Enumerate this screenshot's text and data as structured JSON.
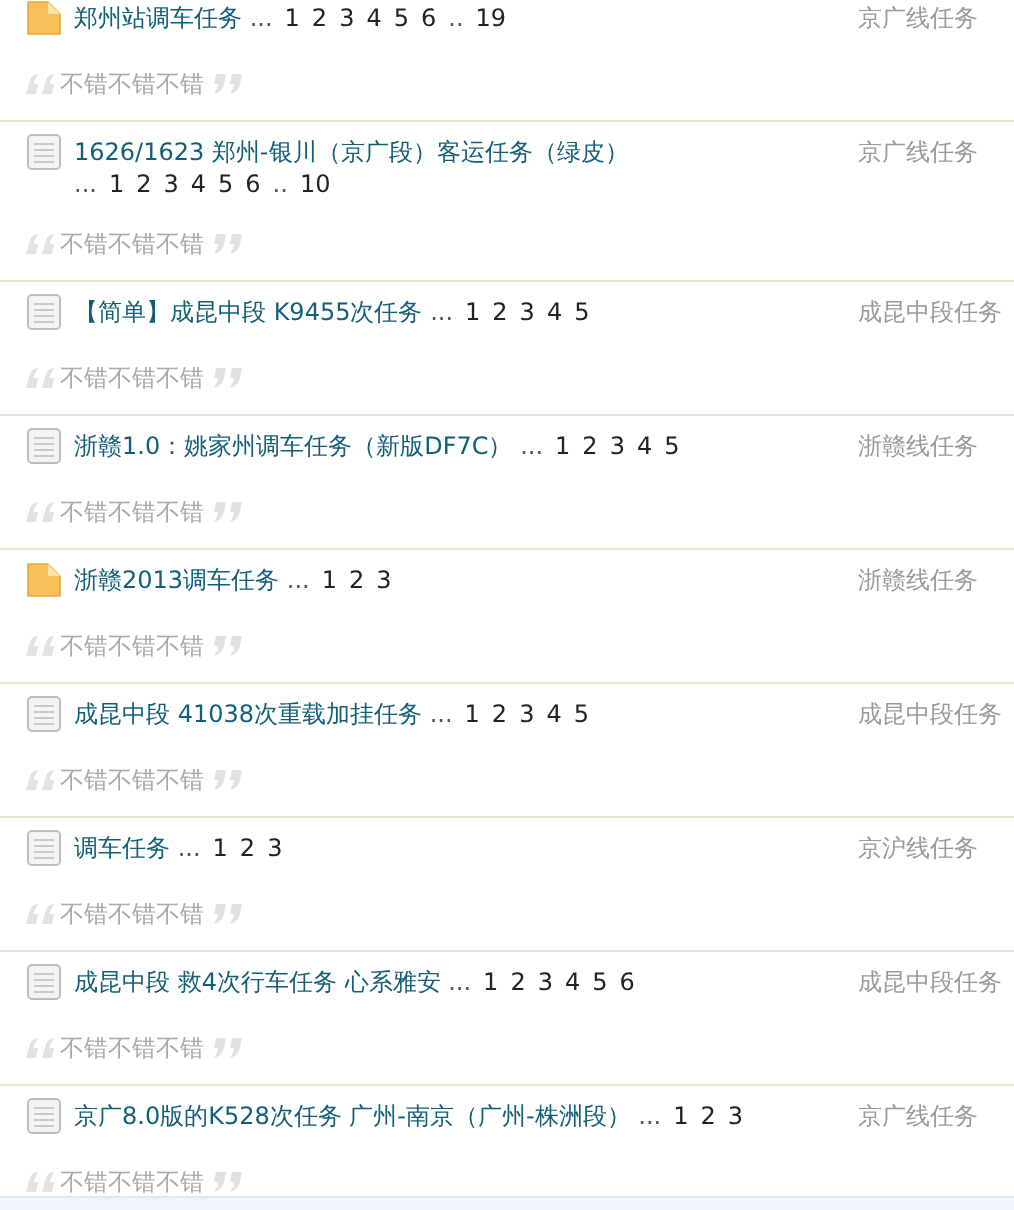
{
  "threads": [
    {
      "kind": "folder",
      "title": "郑州站调车任务",
      "pages": [
        {
          "kind": "gap",
          "text": "..."
        },
        {
          "kind": "link",
          "text": "1"
        },
        {
          "kind": "link",
          "text": "2"
        },
        {
          "kind": "link",
          "text": "3"
        },
        {
          "kind": "link",
          "text": "4"
        },
        {
          "kind": "link",
          "text": "5"
        },
        {
          "kind": "link",
          "text": "6"
        },
        {
          "kind": "gap",
          "text": ".."
        },
        {
          "kind": "link",
          "text": "19"
        }
      ],
      "category": "京广线任务",
      "quote": "不错不错不错"
    },
    {
      "kind": "document",
      "title": "1626/1623 郑州-银川（京广段）客运任务（绿皮）",
      "pages": [
        {
          "kind": "gap",
          "text": "..."
        },
        {
          "kind": "link",
          "text": "1"
        },
        {
          "kind": "link",
          "text": "2"
        },
        {
          "kind": "link",
          "text": "3"
        },
        {
          "kind": "link",
          "text": "4"
        },
        {
          "kind": "link",
          "text": "5"
        },
        {
          "kind": "link",
          "text": "6"
        },
        {
          "kind": "gap",
          "text": ".."
        },
        {
          "kind": "link",
          "text": "10"
        }
      ],
      "category": "京广线任务",
      "quote": "不错不错不错"
    },
    {
      "kind": "document",
      "title": "【简单】成昆中段 K9455次任务",
      "pages": [
        {
          "kind": "gap",
          "text": "..."
        },
        {
          "kind": "link",
          "text": "1"
        },
        {
          "kind": "link",
          "text": "2"
        },
        {
          "kind": "link",
          "text": "3"
        },
        {
          "kind": "link",
          "text": "4"
        },
        {
          "kind": "link",
          "text": "5"
        }
      ],
      "category": "成昆中段任务",
      "quote": "不错不错不错"
    },
    {
      "kind": "document",
      "title": "浙赣1.0：姚家州调车任务（新版DF7C）",
      "pages": [
        {
          "kind": "gap",
          "text": "..."
        },
        {
          "kind": "link",
          "text": "1"
        },
        {
          "kind": "link",
          "text": "2"
        },
        {
          "kind": "link",
          "text": "3"
        },
        {
          "kind": "link",
          "text": "4"
        },
        {
          "kind": "link",
          "text": "5"
        }
      ],
      "category": "浙赣线任务",
      "quote": "不错不错不错"
    },
    {
      "kind": "folder",
      "title": "浙赣2013调车任务",
      "pages": [
        {
          "kind": "gap",
          "text": "..."
        },
        {
          "kind": "link",
          "text": "1"
        },
        {
          "kind": "link",
          "text": "2"
        },
        {
          "kind": "link",
          "text": "3"
        }
      ],
      "category": "浙赣线任务",
      "quote": "不错不错不错"
    },
    {
      "kind": "document",
      "title": "成昆中段 41038次重载加挂任务",
      "pages": [
        {
          "kind": "gap",
          "text": "..."
        },
        {
          "kind": "link",
          "text": "1"
        },
        {
          "kind": "link",
          "text": "2"
        },
        {
          "kind": "link",
          "text": "3"
        },
        {
          "kind": "link",
          "text": "4"
        },
        {
          "kind": "link",
          "text": "5"
        }
      ],
      "category": "成昆中段任务",
      "quote": "不错不错不错"
    },
    {
      "kind": "document",
      "title": "调车任务",
      "pages": [
        {
          "kind": "gap",
          "text": "..."
        },
        {
          "kind": "link",
          "text": "1"
        },
        {
          "kind": "link",
          "text": "2"
        },
        {
          "kind": "link",
          "text": "3"
        }
      ],
      "category": "京沪线任务",
      "quote": "不错不错不错"
    },
    {
      "kind": "document",
      "title": "成昆中段 救4次行车任务 心系雅安",
      "pages": [
        {
          "kind": "gap",
          "text": "..."
        },
        {
          "kind": "link",
          "text": "1"
        },
        {
          "kind": "link",
          "text": "2"
        },
        {
          "kind": "link",
          "text": "3"
        },
        {
          "kind": "link",
          "text": "4"
        },
        {
          "kind": "link",
          "text": "5"
        },
        {
          "kind": "link",
          "text": "6"
        }
      ],
      "category": "成昆中段任务",
      "quote": "不错不错不错"
    },
    {
      "kind": "document",
      "title": "京广8.0版的K528次任务 广州-南京（广州-株洲段）",
      "pages": [
        {
          "kind": "gap",
          "text": "..."
        },
        {
          "kind": "link",
          "text": "1"
        },
        {
          "kind": "link",
          "text": "2"
        },
        {
          "kind": "link",
          "text": "3"
        }
      ],
      "category": "京广线任务",
      "quote": "不错不错不错"
    }
  ]
}
